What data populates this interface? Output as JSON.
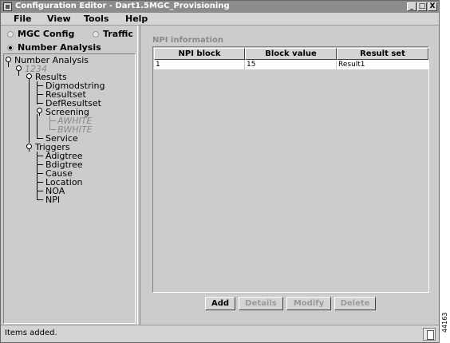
{
  "window": {
    "title": "Configuration Editor - Dart1.5MGC_Provisioning",
    "controls": [
      "_",
      "□",
      "X"
    ]
  },
  "menu": [
    "File",
    "View",
    "Tools",
    "Help"
  ],
  "modes": {
    "mgc_config": "MGC Config",
    "traffic": "Traffic",
    "number_analysis": "Number Analysis",
    "selected": "Number Analysis"
  },
  "tree": {
    "root": "Number Analysis",
    "dial_plan": "1234",
    "results": "Results",
    "digmodstring": "Digmodstring",
    "resultset": "Resultset",
    "defresultset": "DefResultset",
    "screening": "Screening",
    "awhite": "AWHITE",
    "bwhite": "BWHITE",
    "service": "Service",
    "triggers": "Triggers",
    "adigtree": "Adigtree",
    "bdigtree": "Bdigtree",
    "cause": "Cause",
    "location": "Location",
    "noa": "NOA",
    "npi": "NPI"
  },
  "npi_panel": {
    "title": "NPI information",
    "columns": [
      "NPI block",
      "Block value",
      "Result set"
    ],
    "rows": [
      [
        "1",
        "15",
        "Result1"
      ]
    ]
  },
  "buttons": {
    "add": "Add",
    "details": "Details",
    "modify": "Modify",
    "delete": "Delete"
  },
  "status": {
    "message": "Items added."
  },
  "figure_code": "44163",
  "colors": {
    "window_bg": "#cccccc",
    "titlebar": "#8c8c8c",
    "disabled_text": "#9a9a9a"
  }
}
